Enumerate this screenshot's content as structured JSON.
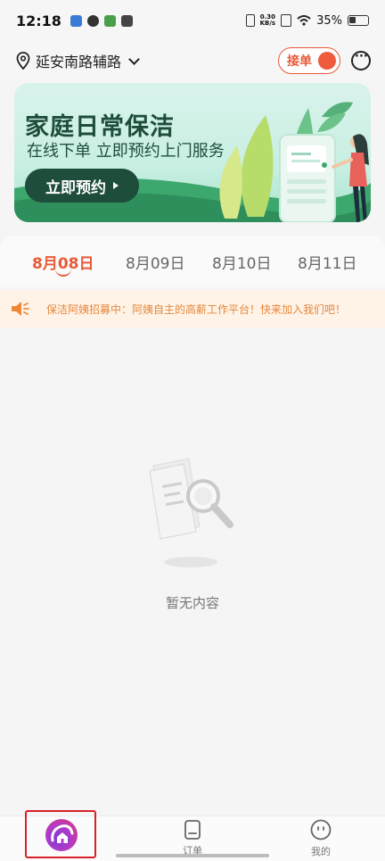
{
  "status_bar": {
    "time": "12:18",
    "net_speed_value": "0.30",
    "net_speed_unit": "KB/s",
    "battery": "35%"
  },
  "header": {
    "location": "延安南路辅路",
    "accept_label": "接单"
  },
  "banner": {
    "title": "家庭日常保洁",
    "subtitle": "在线下单 立即预约上门服务",
    "button_label": "立即预约"
  },
  "dates": [
    "8月08日",
    "8月09日",
    "8月10日",
    "8月11日"
  ],
  "active_date_index": 0,
  "notice": {
    "text": "保洁阿姨招募中：阿姨自主的高薪工作平台！快来加入我们吧！"
  },
  "empty_state": {
    "text": "暂无内容"
  },
  "tabs": [
    {
      "label": "",
      "icon": "home-logo-icon"
    },
    {
      "label": "订单",
      "icon": "order-icon"
    },
    {
      "label": "我的",
      "icon": "profile-icon"
    }
  ],
  "colors": {
    "accent": "#e85a3a",
    "banner_dark": "#1f4d3b",
    "notice_bg": "#fff3e8",
    "notice_text": "#e5883c"
  }
}
